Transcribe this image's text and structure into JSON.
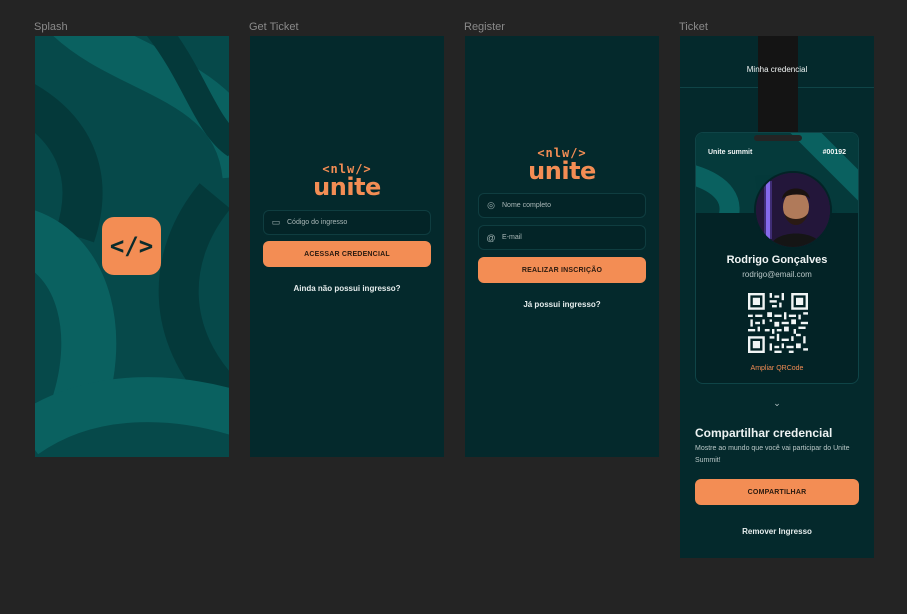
{
  "frames": {
    "splash": "Splash",
    "get_ticket": "Get Ticket",
    "register": "Register",
    "ticket": "Ticket"
  },
  "logo": {
    "top": "<nlw/>",
    "main": "unite",
    "icon": "</>"
  },
  "get_ticket": {
    "input_placeholder": "Código do ingresso",
    "button": "ACESSAR CREDENCIAL",
    "link": "Ainda não possui ingresso?"
  },
  "register": {
    "name_placeholder": "Nome completo",
    "email_placeholder": "E-mail",
    "button": "REALIZAR INSCRIÇÃO",
    "link": "Já possui ingresso?"
  },
  "ticket": {
    "header_title": "Minha credencial",
    "event": "Unite summit",
    "number": "#00192",
    "name": "Rodrigo Gonçalves",
    "email": "rodrigo@email.com",
    "qr_link": "Ampliar QRCode",
    "share_title": "Compartilhar credencial",
    "share_sub": "Mostre ao mundo que você vai participar do Unite Summit!",
    "share_button": "COMPARTILHAR",
    "remove": "Remover Ingresso"
  },
  "colors": {
    "accent": "#f38d54",
    "bg": "#04292c",
    "canvas": "#242424"
  }
}
